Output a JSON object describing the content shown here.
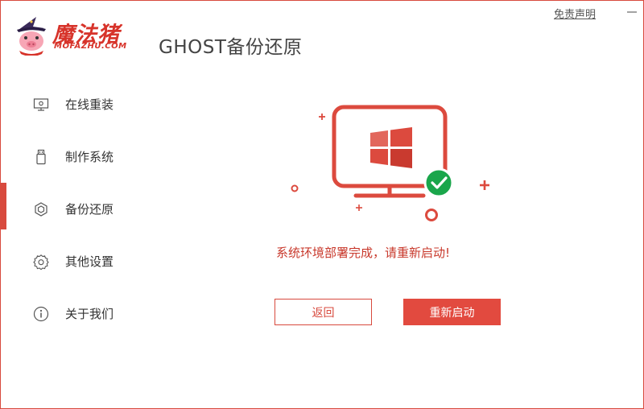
{
  "header": {
    "logo_cn": "魔法猪",
    "logo_en": "MOFAZHU.COM",
    "app_title": "GHOST备份还原",
    "disclaimer": "免责声明"
  },
  "icons": {
    "minimize": "minimize-icon",
    "close": "close-icon",
    "online_reinstall": "monitor-gear-icon",
    "make_system": "usb-drive-icon",
    "backup_restore": "cube-backup-icon",
    "settings": "gear-icon",
    "about": "info-icon",
    "windows_logo": "windows-logo-icon",
    "success": "check-circle-icon"
  },
  "sidebar": {
    "items": [
      {
        "label": "在线重装",
        "active": false
      },
      {
        "label": "制作系统",
        "active": false
      },
      {
        "label": "备份还原",
        "active": true
      },
      {
        "label": "其他设置",
        "active": false
      },
      {
        "label": "关于我们",
        "active": false
      }
    ]
  },
  "main": {
    "status_message": "系统环境部署完成，请重新启动!",
    "back_button": "返回",
    "restart_button": "重新启动"
  },
  "colors": {
    "accent": "#d84a3e",
    "success": "#1aa64b",
    "text": "#333333"
  }
}
